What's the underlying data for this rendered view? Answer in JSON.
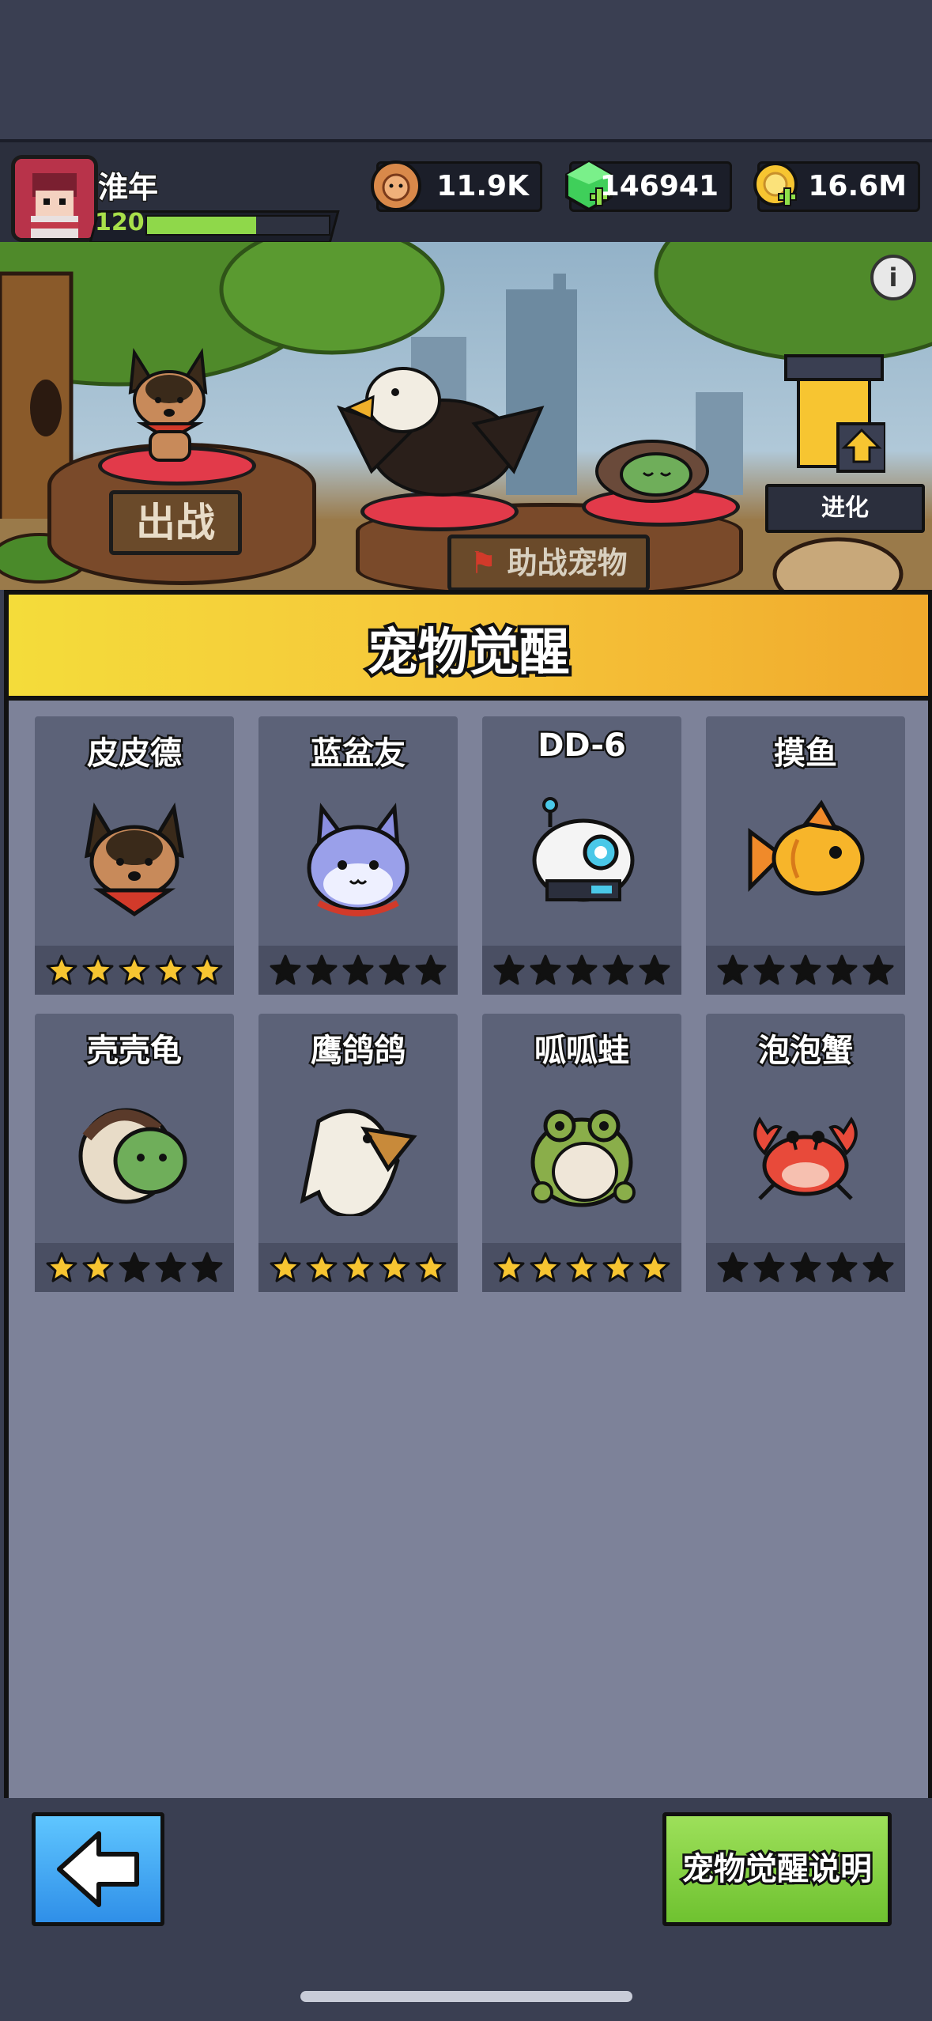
{
  "player": {
    "name": "淮年",
    "level": "120",
    "xp_fraction": 0.6
  },
  "currencies": [
    {
      "icon": "coin-face-icon",
      "value": "11.9K"
    },
    {
      "icon": "green-gem-icon",
      "value": "146941"
    },
    {
      "icon": "gold-coin-icon",
      "value": "16.6M"
    }
  ],
  "scene": {
    "deploy_label": "出战",
    "assist_label": "助战宠物",
    "evolve_label": "进化",
    "info_icon": "info-icon"
  },
  "panel": {
    "title": "宠物觉醒",
    "pets": [
      {
        "name": "皮皮德",
        "stars": 5,
        "icon": "dog-icon"
      },
      {
        "name": "蓝盆友",
        "stars": 0,
        "icon": "blue-cat-icon"
      },
      {
        "name": "DD-6",
        "stars": 0,
        "icon": "robot-icon"
      },
      {
        "name": "摸鱼",
        "stars": 0,
        "icon": "goldfish-icon"
      },
      {
        "name": "壳壳龟",
        "stars": 2,
        "icon": "turtle-icon"
      },
      {
        "name": "鹰鸽鸽",
        "stars": 5,
        "icon": "eagle-icon"
      },
      {
        "name": "呱呱蛙",
        "stars": 5,
        "icon": "frog-icon"
      },
      {
        "name": "泡泡蟹",
        "stars": 0,
        "icon": "crab-icon"
      }
    ]
  },
  "bottom": {
    "help_label": "宠物觉醒说明",
    "back_icon": "back-arrow-icon"
  },
  "colors": {
    "star_gold": "#f7c531",
    "star_empty": "#111111",
    "panel_header": "#f4c83a",
    "help_button": "#8fd84a",
    "back_button": "#4aaef8"
  }
}
